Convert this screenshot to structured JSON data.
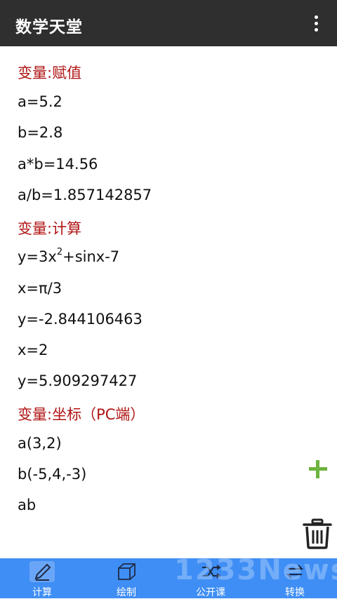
{
  "app": {
    "title": "数学天堂"
  },
  "sections": [
    {
      "header": "变量:赋值",
      "lines": [
        "a=5.2",
        "b=2.8",
        "a*b=14.56",
        "a/b=1.857142857"
      ]
    },
    {
      "header": "变量:计算",
      "lines_pre": "y=3x",
      "lines_sup": "2",
      "lines_post": "+sinx-7",
      "lines": [
        "x=π/3",
        "y=-2.844106463",
        "x=2",
        "y=5.909297427"
      ]
    },
    {
      "header": "变量:坐标（PC端）",
      "lines": [
        "a(3,2)",
        "b(-5,4,-3)",
        "ab"
      ]
    }
  ],
  "tabs": [
    {
      "label": "计算",
      "icon": "pencil-icon",
      "active": true
    },
    {
      "label": "绘制",
      "icon": "cube-icon",
      "active": false
    },
    {
      "label": "公开课",
      "icon": "shuffle-icon",
      "active": false
    },
    {
      "label": "转换",
      "icon": "convert-icon",
      "active": false
    }
  ],
  "watermark": "1233News",
  "colors": {
    "appbar": "#2f2f2f",
    "section": "#b01414",
    "bottombar": "#3f8ef5",
    "add": "#6db33f"
  }
}
